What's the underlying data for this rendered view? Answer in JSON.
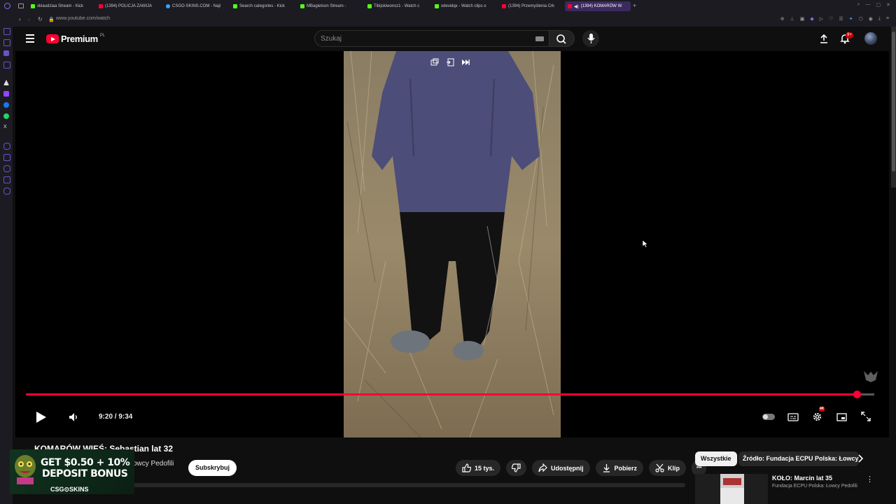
{
  "browser": {
    "tabs": [
      {
        "label": "xklaudziaa Stream - Kick",
        "color": "#53fc18"
      },
      {
        "label": "(1394) POLICJA ZAWIJA",
        "color": "#ff0033"
      },
      {
        "label": "CSGO-SKINS.COM - Najl",
        "color": "#3aa0ff"
      },
      {
        "label": "Search categories - Kick",
        "color": "#53fc18"
      },
      {
        "label": "MBagietson Stream -",
        "color": "#53fc18"
      },
      {
        "label": "Tibijskiwonsz1 - Watch c",
        "color": "#53fc18"
      },
      {
        "label": "xdevidqx - Watch clips o",
        "color": "#53fc18"
      },
      {
        "label": "(1394) Przemyślenia Crk",
        "color": "#ff0033"
      },
      {
        "label": "(1394) KOMARÓW W",
        "color": "#ff0033"
      }
    ],
    "new_tab": "+",
    "url": "www.youtube.com/watch"
  },
  "header": {
    "logo_text": "Premium",
    "logo_region": "PL",
    "search_placeholder": "Szukaj",
    "notification_count": "9+"
  },
  "player": {
    "time": "9:20 / 9:34",
    "progress": 0.979,
    "quality_badge": "4K"
  },
  "video": {
    "title": "KOMARÓW WIEŚ: Sebastian lat 32",
    "channel": "owcy Pedofili",
    "subscribe_label": "Subskrybuj",
    "likes": "15 tys.",
    "share_label": "Udostępnij",
    "download_label": "Pobierz",
    "clip_label": "Klip",
    "more_label": "•••"
  },
  "sidebar_right": {
    "chips": [
      "Wszystkie",
      "Źródło: Fundacja ECPU Polska: Łowcy"
    ],
    "rec": {
      "title": "KOŁO: Marcin lat 35",
      "channel": "Fundacja ECPU Polska: Łowcy Pedofili"
    }
  },
  "ad": {
    "line1": "GET $0.50 + 10%",
    "line2": "DEPOSIT BONUS",
    "brand": "CSG⊙SKINS"
  },
  "colors": {
    "brand_red": "#ff0033",
    "background": "#0f0f0f"
  }
}
